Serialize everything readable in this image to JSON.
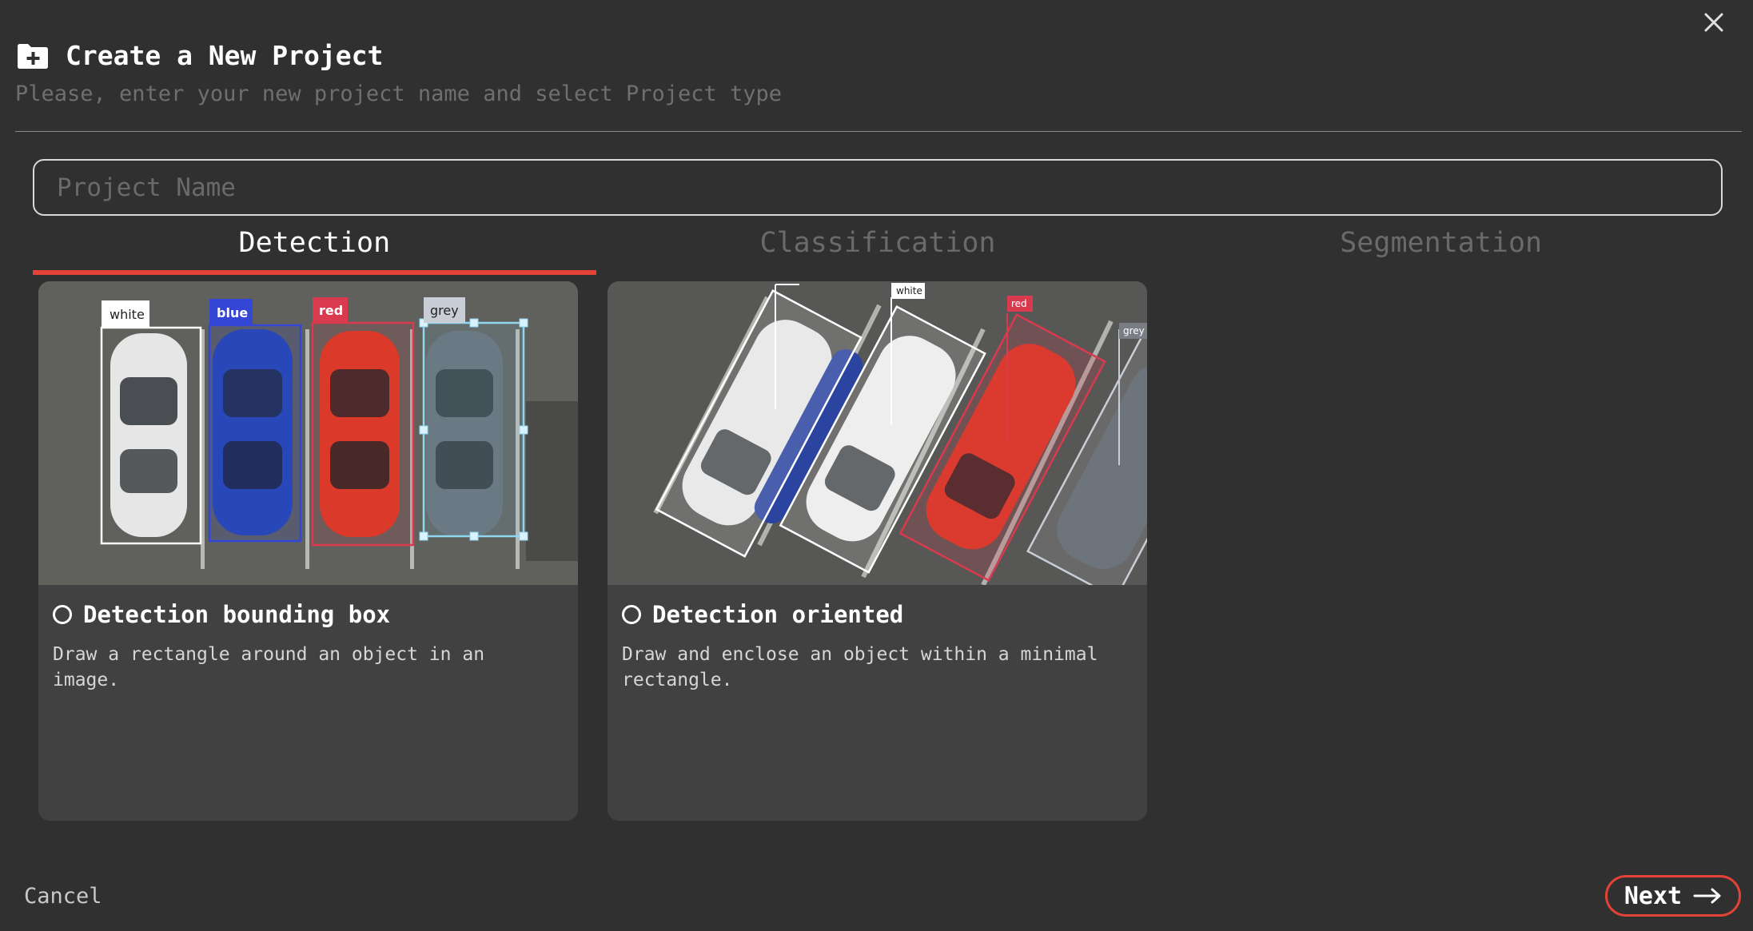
{
  "dialog": {
    "title": "Create a New Project",
    "subtitle": "Please, enter your new project name and select Project type",
    "folder_icon": "folder-plus-icon",
    "close_icon": "close-icon"
  },
  "project_name": {
    "value": "",
    "placeholder": "Project Name"
  },
  "tabs": [
    {
      "label": "Detection",
      "active": true
    },
    {
      "label": "Classification",
      "active": false
    },
    {
      "label": "Segmentation",
      "active": false
    }
  ],
  "cards": [
    {
      "title": "Detection bounding box",
      "description": "Draw a rectangle around an object in an image.",
      "selected": false,
      "image_labels": [
        "white",
        "blue",
        "red",
        "grey"
      ]
    },
    {
      "title": "Detection oriented",
      "description": "Draw and enclose an object within a minimal rectangle.",
      "selected": false,
      "image_labels": [
        "white",
        "red",
        "grey"
      ]
    }
  ],
  "footer": {
    "cancel_label": "Cancel",
    "next_label": "Next",
    "next_icon": "arrow-right-icon"
  },
  "colors": {
    "accent": "#e24336",
    "background": "#303030",
    "card": "#414141",
    "label_white": "#ffffff",
    "label_blue": "#3346d6",
    "label_red": "#d93a4e",
    "label_grey": "#c9cdd6"
  }
}
